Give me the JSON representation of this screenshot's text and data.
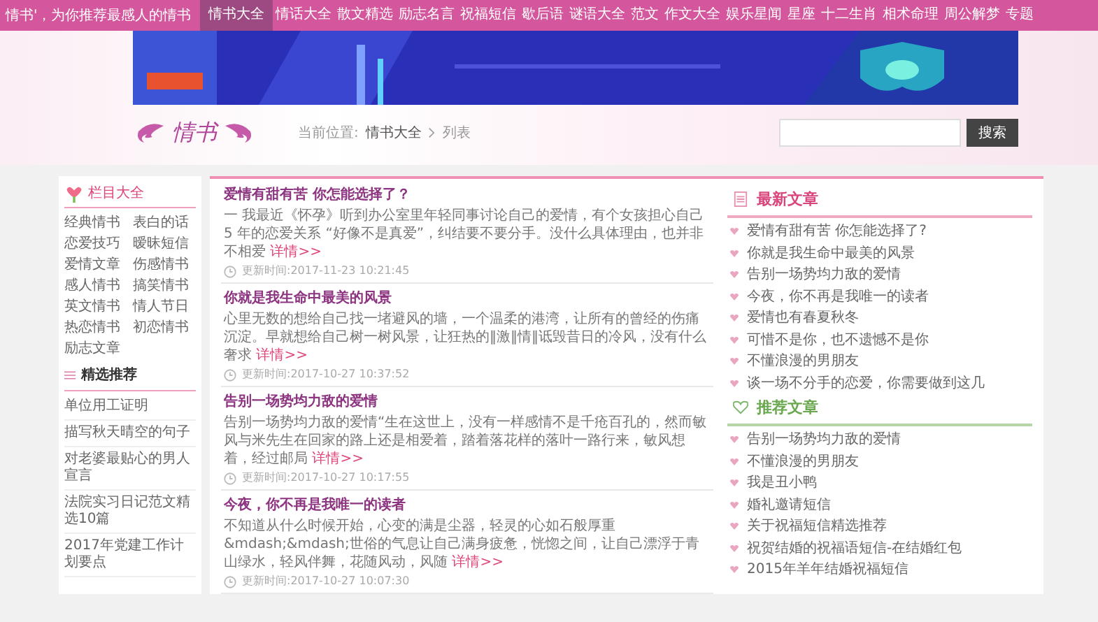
{
  "top_bar": {
    "tagline": "情书'，为你推荐最感人的情书",
    "nav": [
      {
        "label": "情书大全",
        "selected": true
      },
      {
        "label": "情话大全",
        "selected": false
      },
      {
        "label": "散文精选",
        "selected": false
      },
      {
        "label": "励志名言",
        "selected": false
      },
      {
        "label": "祝福短信",
        "selected": false
      },
      {
        "label": "歇后语",
        "selected": false
      },
      {
        "label": "谜语大全",
        "selected": false
      },
      {
        "label": "范文",
        "selected": false
      },
      {
        "label": "作文大全",
        "selected": false
      },
      {
        "label": "娱乐星闻",
        "selected": false
      },
      {
        "label": "星座",
        "selected": false
      },
      {
        "label": "十二生肖",
        "selected": false
      },
      {
        "label": "相术命理",
        "selected": false
      },
      {
        "label": "周公解梦",
        "selected": false
      },
      {
        "label": "专题",
        "selected": false
      }
    ]
  },
  "header": {
    "logo_text": "情书",
    "breadcrumb_label": "当前位置:",
    "breadcrumb": [
      "情书大全",
      "列表"
    ],
    "search_button": "搜索"
  },
  "sidebar": {
    "title": "栏目大全",
    "categories": [
      "经典情书",
      "表白的话",
      "恋爱技巧",
      "暧昧短信",
      "爱情文章",
      "伤感情书",
      "感人情书",
      "搞笑情书",
      "英文情书",
      "情人节日",
      "热恋情书",
      "初恋情书",
      "励志文章"
    ],
    "featured_title": "精选推荐",
    "featured": [
      "单位用工证明",
      "描写秋天晴空的句子",
      "对老婆最贴心的男人宣言",
      "法院实习日记范文精选10篇",
      "2017年党建工作计划要点"
    ]
  },
  "articles": [
    {
      "title": "爱情有甜有苦 你怎能选择了？",
      "excerpt": "一 我最近《怀孕》听到办公室里年轻同事讨论自己的爱情，有个女孩担心自己 5 年的恋爱关系 “好像不是真爱”，纠结要不要分手。没什么具体理由，也并非不相爱",
      "more": "详情>>",
      "time": "更新时间:2017-11-23 10:21:45"
    },
    {
      "title": "你就是我生命中最美的风景",
      "excerpt": "心里无数的想给自己找一堵避风的墙，一个温柔的港湾，让所有的曾经的伤痛沉淀。早就想给自己树一树风景，让狂热的‖激‖情‖诋毁昔日的冷风，没有什么奢求",
      "more": "详情>>",
      "time": "更新时间:2017-10-27 10:37:52"
    },
    {
      "title": "告别一场势均力敌的爱情",
      "excerpt": "告别一场势均力敌的爱情“生在这世上，没有一样感情不是千疮百孔的，然而敏风与米先生在回家的路上还是相爱着，踏着落花样的落叶一路行来，敏风想着，经过邮局",
      "more": "详情>>",
      "time": "更新时间:2017-10-27 10:17:55"
    },
    {
      "title": "今夜，你不再是我唯一的读者",
      "excerpt": "不知道从什么时候开始，心变的满是尘器，轻灵的心如石般厚重&mdash;&mdash;世俗的气息让自己满身疲惫，恍惚之间，让自己漂浮于青山绿水，轻风伴舞，花随风动，风随",
      "more": "详情>>",
      "time": "更新时间:2017-10-27 10:07:30"
    }
  ],
  "latest": {
    "title": "最新文章",
    "items": [
      "爱情有甜有苦 你怎能选择了?",
      "你就是我生命中最美的风景",
      "告别一场势均力敌的爱情",
      "今夜，你不再是我唯一的读者",
      "爱情也有春夏秋冬",
      "可惜不是你，也不遗憾不是你",
      "不懂浪漫的男朋友",
      "谈一场不分手的恋爱，你需要做到这几"
    ]
  },
  "recommended": {
    "title": "推荐文章",
    "items": [
      "告别一场势均力敌的爱情",
      "不懂浪漫的男朋友",
      "我是丑小鸭",
      "婚礼邀请短信",
      "关于祝福短信精选推荐",
      "祝贺结婚的祝福语短信-在结婚红包",
      "2015年羊年结婚祝福短信"
    ]
  }
}
